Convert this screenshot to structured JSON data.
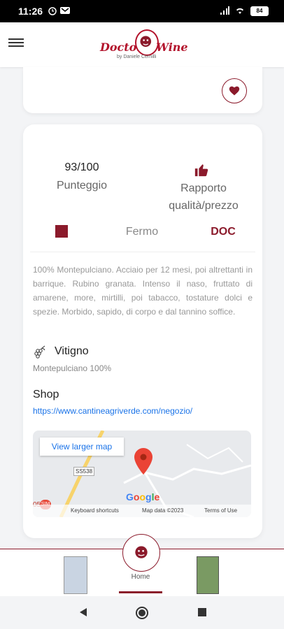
{
  "status_bar": {
    "time": "11:26",
    "battery": "84"
  },
  "header": {
    "logo_left": "Doctor",
    "logo_right": "Wine",
    "logo_sub": "by Daniele Cernilli"
  },
  "wine": {
    "score_value": "93/100",
    "score_label": "Punteggio",
    "quality_price_label": "Rapporto qualità/prezzo",
    "type": "Fermo",
    "denomination": "DOC",
    "description": "100% Montepulciano. Acciaio per 12 mesi, poi altrettanti in barrique. Rubino granata. Intenso il naso, fruttato di amarene, more, mirtilli, poi tabacco, tostature dolci e spezie. Morbido, sapido, di corpo e dal tannino soffice.",
    "grape_title": "Vitigno",
    "grape_value": "Montepulciano 100%",
    "shop_title": "Shop",
    "shop_link": "https://www.cantineagriverde.com/negozio/"
  },
  "map": {
    "view_larger": "View larger map",
    "road_badge": "SS538",
    "road_label": "05",
    "road_dot": "SIM",
    "brand": "Google",
    "shortcuts": "Keyboard shortcuts",
    "map_data": "Map data ©2023",
    "terms": "Terms of Use"
  },
  "bottom_nav": {
    "home_label": "Home"
  },
  "colors": {
    "brand": "#8b1a2b",
    "link": "#1a73e8"
  }
}
